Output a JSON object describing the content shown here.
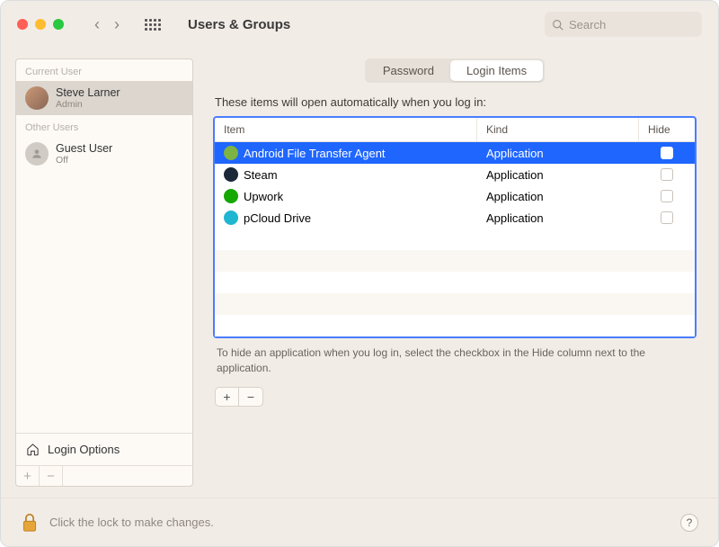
{
  "window": {
    "title": "Users & Groups"
  },
  "search": {
    "placeholder": "Search"
  },
  "sidebar": {
    "current_label": "Current User",
    "other_label": "Other Users",
    "current_user": {
      "name": "Steve Larner",
      "role": "Admin"
    },
    "guest": {
      "name": "Guest User",
      "status": "Off"
    },
    "login_options": "Login Options"
  },
  "tabs": {
    "password": "Password",
    "login_items": "Login Items"
  },
  "main": {
    "description": "These items will open automatically when you log in:",
    "columns": {
      "item": "Item",
      "kind": "Kind",
      "hide": "Hide"
    },
    "rows": [
      {
        "icon": "android",
        "name": "Android File Transfer Agent",
        "kind": "Application",
        "hide": false,
        "selected": true
      },
      {
        "icon": "steam",
        "name": "Steam",
        "kind": "Application",
        "hide": false,
        "selected": false
      },
      {
        "icon": "upwork",
        "name": "Upwork",
        "kind": "Application",
        "hide": false,
        "selected": false
      },
      {
        "icon": "pcloud",
        "name": "pCloud Drive",
        "kind": "Application",
        "hide": false,
        "selected": false
      }
    ],
    "hint": "To hide an application when you log in, select the checkbox in the Hide column next to the application."
  },
  "footer": {
    "lock_text": "Click the lock to make changes."
  }
}
